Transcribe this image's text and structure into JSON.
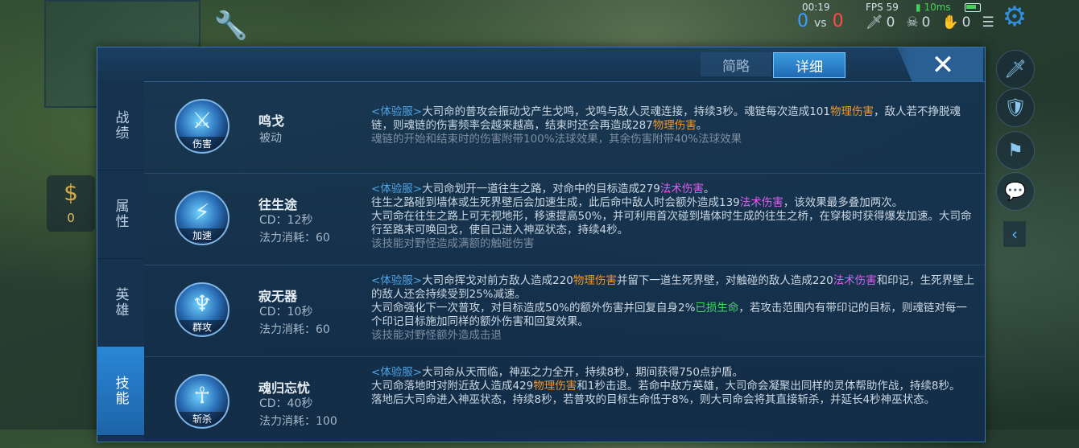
{
  "hud": {
    "time": "00:19",
    "fps": "FPS 59",
    "ping": "10ms",
    "score_blue": "0",
    "score_vs": "vs",
    "score_red": "0",
    "kills": "0",
    "deaths": "0",
    "assists": "0",
    "gold": "0"
  },
  "tabs": {
    "simple": "简略",
    "detail": "详细"
  },
  "nav": [
    "战绩",
    "属性",
    "英雄",
    "技能"
  ],
  "skills": [
    {
      "icon_tag": "伤害",
      "name": "鸣戈",
      "meta1": "被动",
      "meta2": "",
      "desc": [
        [
          [
            "trial",
            "<体验服>"
          ],
          [
            "t",
            "大司命的普攻会振动戈产生戈鸣，戈鸣与敌人灵魂连接，持续3秒。魂链每次造成101"
          ],
          [
            "phys",
            "物理伤害"
          ],
          [
            "t",
            "，敌人若不挣脱魂链，则魂链的伤害频率会越来越高，结束时还会再造成287"
          ],
          [
            "phys",
            "物理伤害"
          ],
          [
            "t",
            "。"
          ]
        ],
        [
          [
            "note",
            "魂链的开始和结束时的伤害附带100%法球效果，其余伤害附带40%法球效果"
          ]
        ]
      ]
    },
    {
      "icon_tag": "加速",
      "name": "往生途",
      "meta1": "CD：12秒",
      "meta2": "法力消耗：60",
      "desc": [
        [
          [
            "trial",
            "<体验服>"
          ],
          [
            "t",
            "大司命划开一道往生之路，对命中的目标造成279"
          ],
          [
            "magic",
            "法术伤害"
          ],
          [
            "t",
            "。"
          ]
        ],
        [
          [
            "t",
            "往生之路碰到墙体或生死界壁后会加速生成，此后命中敌人时会额外造成139"
          ],
          [
            "magic",
            "法术伤害"
          ],
          [
            "t",
            "，该效果最多叠加两次。"
          ]
        ],
        [
          [
            "t",
            "大司命在往生之路上可无视地形，移速提高50%，并可利用首次碰到墙体时生成的往生之桥，在穿梭时获得爆发加速。大司命行至路末可唤回戈，使自己进入神巫状态，持续4秒。"
          ]
        ],
        [
          [
            "note",
            "该技能对野怪造成满额的触碰伤害"
          ]
        ]
      ]
    },
    {
      "icon_tag": "群攻",
      "name": "寂无器",
      "meta1": "CD：10秒",
      "meta2": "法力消耗：60",
      "desc": [
        [
          [
            "trial",
            "<体验服>"
          ],
          [
            "t",
            "大司命挥戈对前方敌人造成220"
          ],
          [
            "phys",
            "物理伤害"
          ],
          [
            "t",
            "并留下一道生死界壁，对触碰的敌人造成220"
          ],
          [
            "magic",
            "法术伤害"
          ],
          [
            "t",
            "和印记，生死界壁上的敌人还会持续受到25%减速。"
          ]
        ],
        [
          [
            "t",
            "大司命强化下一次普攻，对目标造成50%的额外伤害并回复自身2%"
          ],
          [
            "heal",
            "已损生命"
          ],
          [
            "t",
            "，若攻击范围内有带印记的目标，则魂链对每一个印记目标施加同样的额外伤害和回复效果。"
          ]
        ],
        [
          [
            "note",
            "该技能对野怪额外造成击退"
          ]
        ]
      ]
    },
    {
      "icon_tag": "斩杀",
      "name": "魂归忘忧",
      "meta1": "CD：40秒",
      "meta2": "法力消耗：100",
      "desc": [
        [
          [
            "trial",
            "<体验服>"
          ],
          [
            "t",
            "大司命从天而临，神巫之力全开，持续8秒，期间获得750点护盾。"
          ]
        ],
        [
          [
            "t",
            "大司命落地时对附近敌人造成429"
          ],
          [
            "phys",
            "物理伤害"
          ],
          [
            "t",
            "和1秒击退。若命中敌方英雄，大司命会凝聚出同样的灵体帮助作战，持续8秒。"
          ]
        ],
        [
          [
            "t",
            "落地后大司命进入神巫状态，持续8秒，若普攻的目标生命低于8%，则大司命会将其直接斩杀，并延长4秒神巫状态。"
          ]
        ]
      ]
    }
  ]
}
